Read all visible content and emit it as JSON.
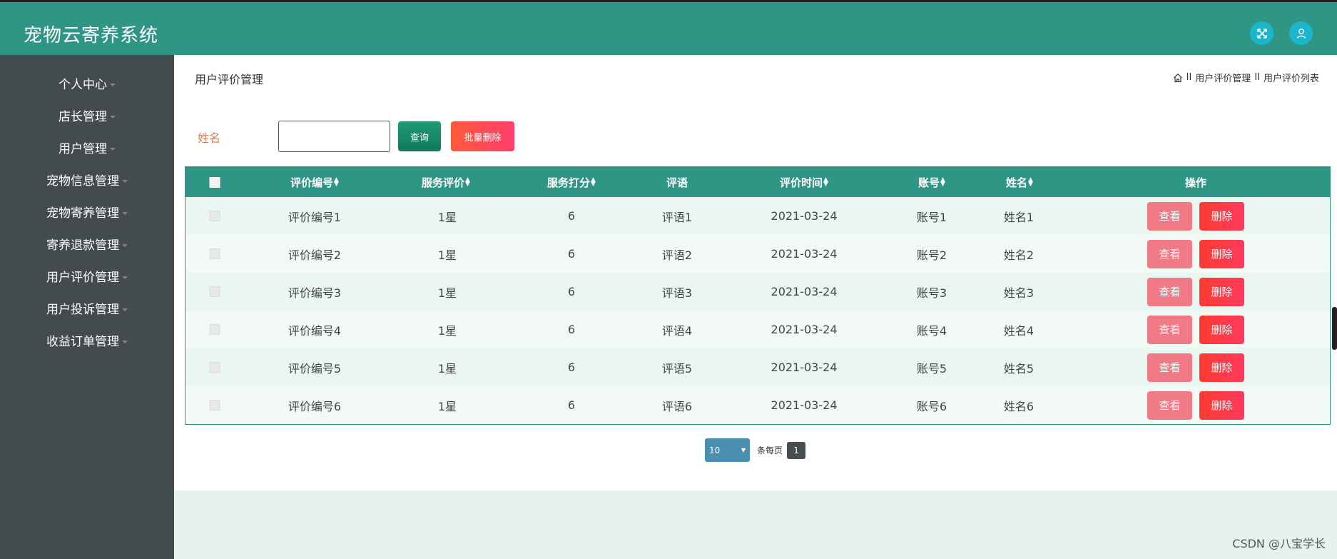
{
  "app": {
    "title": "宠物云寄养系统"
  },
  "colors": {
    "header": "#2f9585",
    "sidebar": "#434b4e",
    "accent_button": "#1bb6c9"
  },
  "topbar": {
    "icons": [
      "fullscreen-icon",
      "user-icon"
    ]
  },
  "sidebar": {
    "items": [
      {
        "label": "个人中心"
      },
      {
        "label": "店长管理"
      },
      {
        "label": "用户管理"
      },
      {
        "label": "宠物信息管理"
      },
      {
        "label": "宠物寄养管理"
      },
      {
        "label": "寄养退款管理"
      },
      {
        "label": "用户评价管理"
      },
      {
        "label": "用户投诉管理"
      },
      {
        "label": "收益订单管理"
      }
    ]
  },
  "page": {
    "title": "用户评价管理",
    "breadcrumb": [
      "II",
      "用户评价管理",
      "II",
      "用户评价列表"
    ]
  },
  "search": {
    "label": "姓名",
    "value": "",
    "query_label": "查询",
    "batch_delete_label": "批量删除"
  },
  "table": {
    "columns": [
      "评价编号",
      "服务评价",
      "服务打分",
      "评语",
      "评价时间",
      "账号",
      "姓名",
      "操作"
    ],
    "rows": [
      {
        "id": "评价编号1",
        "service": "1星",
        "score": "6",
        "comment": "评语1",
        "time": "2021-03-24",
        "account": "账号1",
        "name": "姓名1"
      },
      {
        "id": "评价编号2",
        "service": "1星",
        "score": "6",
        "comment": "评语2",
        "time": "2021-03-24",
        "account": "账号2",
        "name": "姓名2"
      },
      {
        "id": "评价编号3",
        "service": "1星",
        "score": "6",
        "comment": "评语3",
        "time": "2021-03-24",
        "account": "账号3",
        "name": "姓名3"
      },
      {
        "id": "评价编号4",
        "service": "1星",
        "score": "6",
        "comment": "评语4",
        "time": "2021-03-24",
        "account": "账号4",
        "name": "姓名4"
      },
      {
        "id": "评价编号5",
        "service": "1星",
        "score": "6",
        "comment": "评语5",
        "time": "2021-03-24",
        "account": "账号5",
        "name": "姓名5"
      },
      {
        "id": "评价编号6",
        "service": "1星",
        "score": "6",
        "comment": "评语6",
        "time": "2021-03-24",
        "account": "账号6",
        "name": "姓名6"
      }
    ],
    "view_label": "查看",
    "delete_label": "删除"
  },
  "pagination": {
    "page_size": "10",
    "per_page_label": "条每页",
    "current_page": "1"
  },
  "watermark": "CSDN @八宝学长"
}
